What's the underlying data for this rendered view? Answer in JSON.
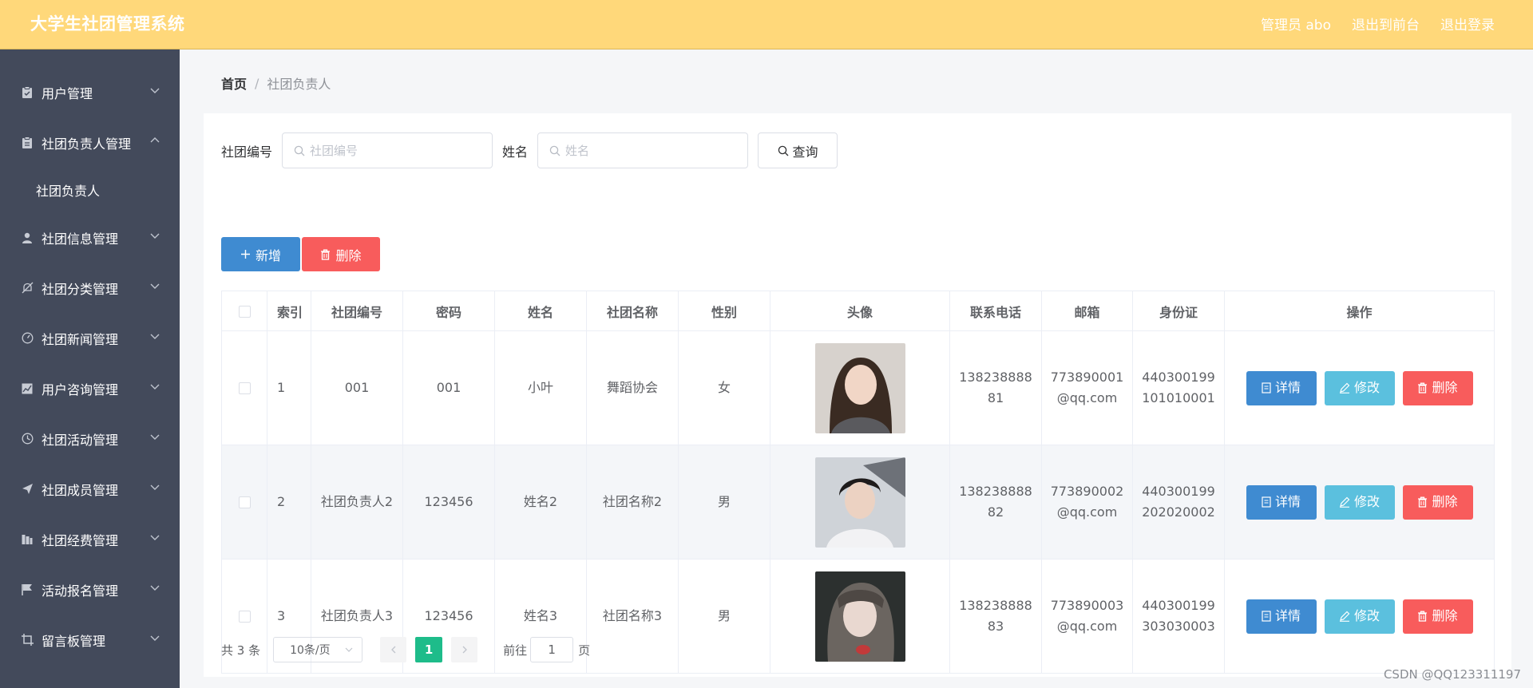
{
  "header": {
    "title": "大学生社团管理系统",
    "admin_label": "管理员 abo",
    "to_front": "退出到前台",
    "logout": "退出登录"
  },
  "sidebar": {
    "items": [
      {
        "label": "用户管理",
        "icon": "clipboard-icon"
      },
      {
        "label": "社团负责人管理",
        "icon": "clipboard-icon"
      },
      {
        "label": "社团信息管理",
        "icon": "user-icon"
      },
      {
        "label": "社团分类管理",
        "icon": "bell-off-icon"
      },
      {
        "label": "社团新闻管理",
        "icon": "gauge-icon"
      },
      {
        "label": "用户咨询管理",
        "icon": "chart-icon"
      },
      {
        "label": "社团活动管理",
        "icon": "clock-icon"
      },
      {
        "label": "社团成员管理",
        "icon": "send-icon"
      },
      {
        "label": "社团经费管理",
        "icon": "building-icon"
      },
      {
        "label": "活动报名管理",
        "icon": "flag-icon"
      },
      {
        "label": "留言板管理",
        "icon": "crop-icon"
      }
    ],
    "sub_item": "社团负责人"
  },
  "breadcrumb": {
    "home": "首页",
    "separator": "/",
    "current": "社团负责人"
  },
  "search": {
    "club_no_label": "社团编号",
    "club_no_placeholder": "社团编号",
    "name_label": "姓名",
    "name_placeholder": "姓名",
    "query_button": "查询"
  },
  "actions": {
    "add": "新增",
    "delete": "删除"
  },
  "table": {
    "headers": [
      "索引",
      "社团编号",
      "密码",
      "姓名",
      "社团名称",
      "性别",
      "头像",
      "联系电话",
      "邮箱",
      "身份证",
      "操作"
    ],
    "rows": [
      {
        "index": "1",
        "club_no": "001",
        "password": "001",
        "name": "小叶",
        "club_name": "舞蹈协会",
        "gender": "女",
        "phone_a": "138238888",
        "phone_b": "81",
        "email_a": "773890001",
        "email_b": "@qq.com",
        "id_a": "440300199",
        "id_b": "101010001"
      },
      {
        "index": "2",
        "club_no": "社团负责人2",
        "password": "123456",
        "name": "姓名2",
        "club_name": "社团名称2",
        "gender": "男",
        "phone_a": "138238888",
        "phone_b": "82",
        "email_a": "773890002",
        "email_b": "@qq.com",
        "id_a": "440300199",
        "id_b": "202020002"
      },
      {
        "index": "3",
        "club_no": "社团负责人3",
        "password": "123456",
        "name": "姓名3",
        "club_name": "社团名称3",
        "gender": "男",
        "phone_a": "138238888",
        "phone_b": "83",
        "email_a": "773890003",
        "email_b": "@qq.com",
        "id_a": "440300199",
        "id_b": "303030003"
      }
    ],
    "op_detail": "详情",
    "op_edit": "修改",
    "op_delete": "删除"
  },
  "pagination": {
    "total": "共 3 条",
    "page_size": "10条/页",
    "current_page": "1",
    "goto_label": "前往",
    "goto_value": "1",
    "page_unit": "页"
  },
  "watermark": "CSDN @QQ123311197",
  "colors": {
    "header_bg": "#ffd87a",
    "sidebar_bg": "#434a5b",
    "primary": "#3f8bd1",
    "info": "#5bc0de",
    "danger": "#f85c5c",
    "page_active": "#1ebc8a"
  }
}
